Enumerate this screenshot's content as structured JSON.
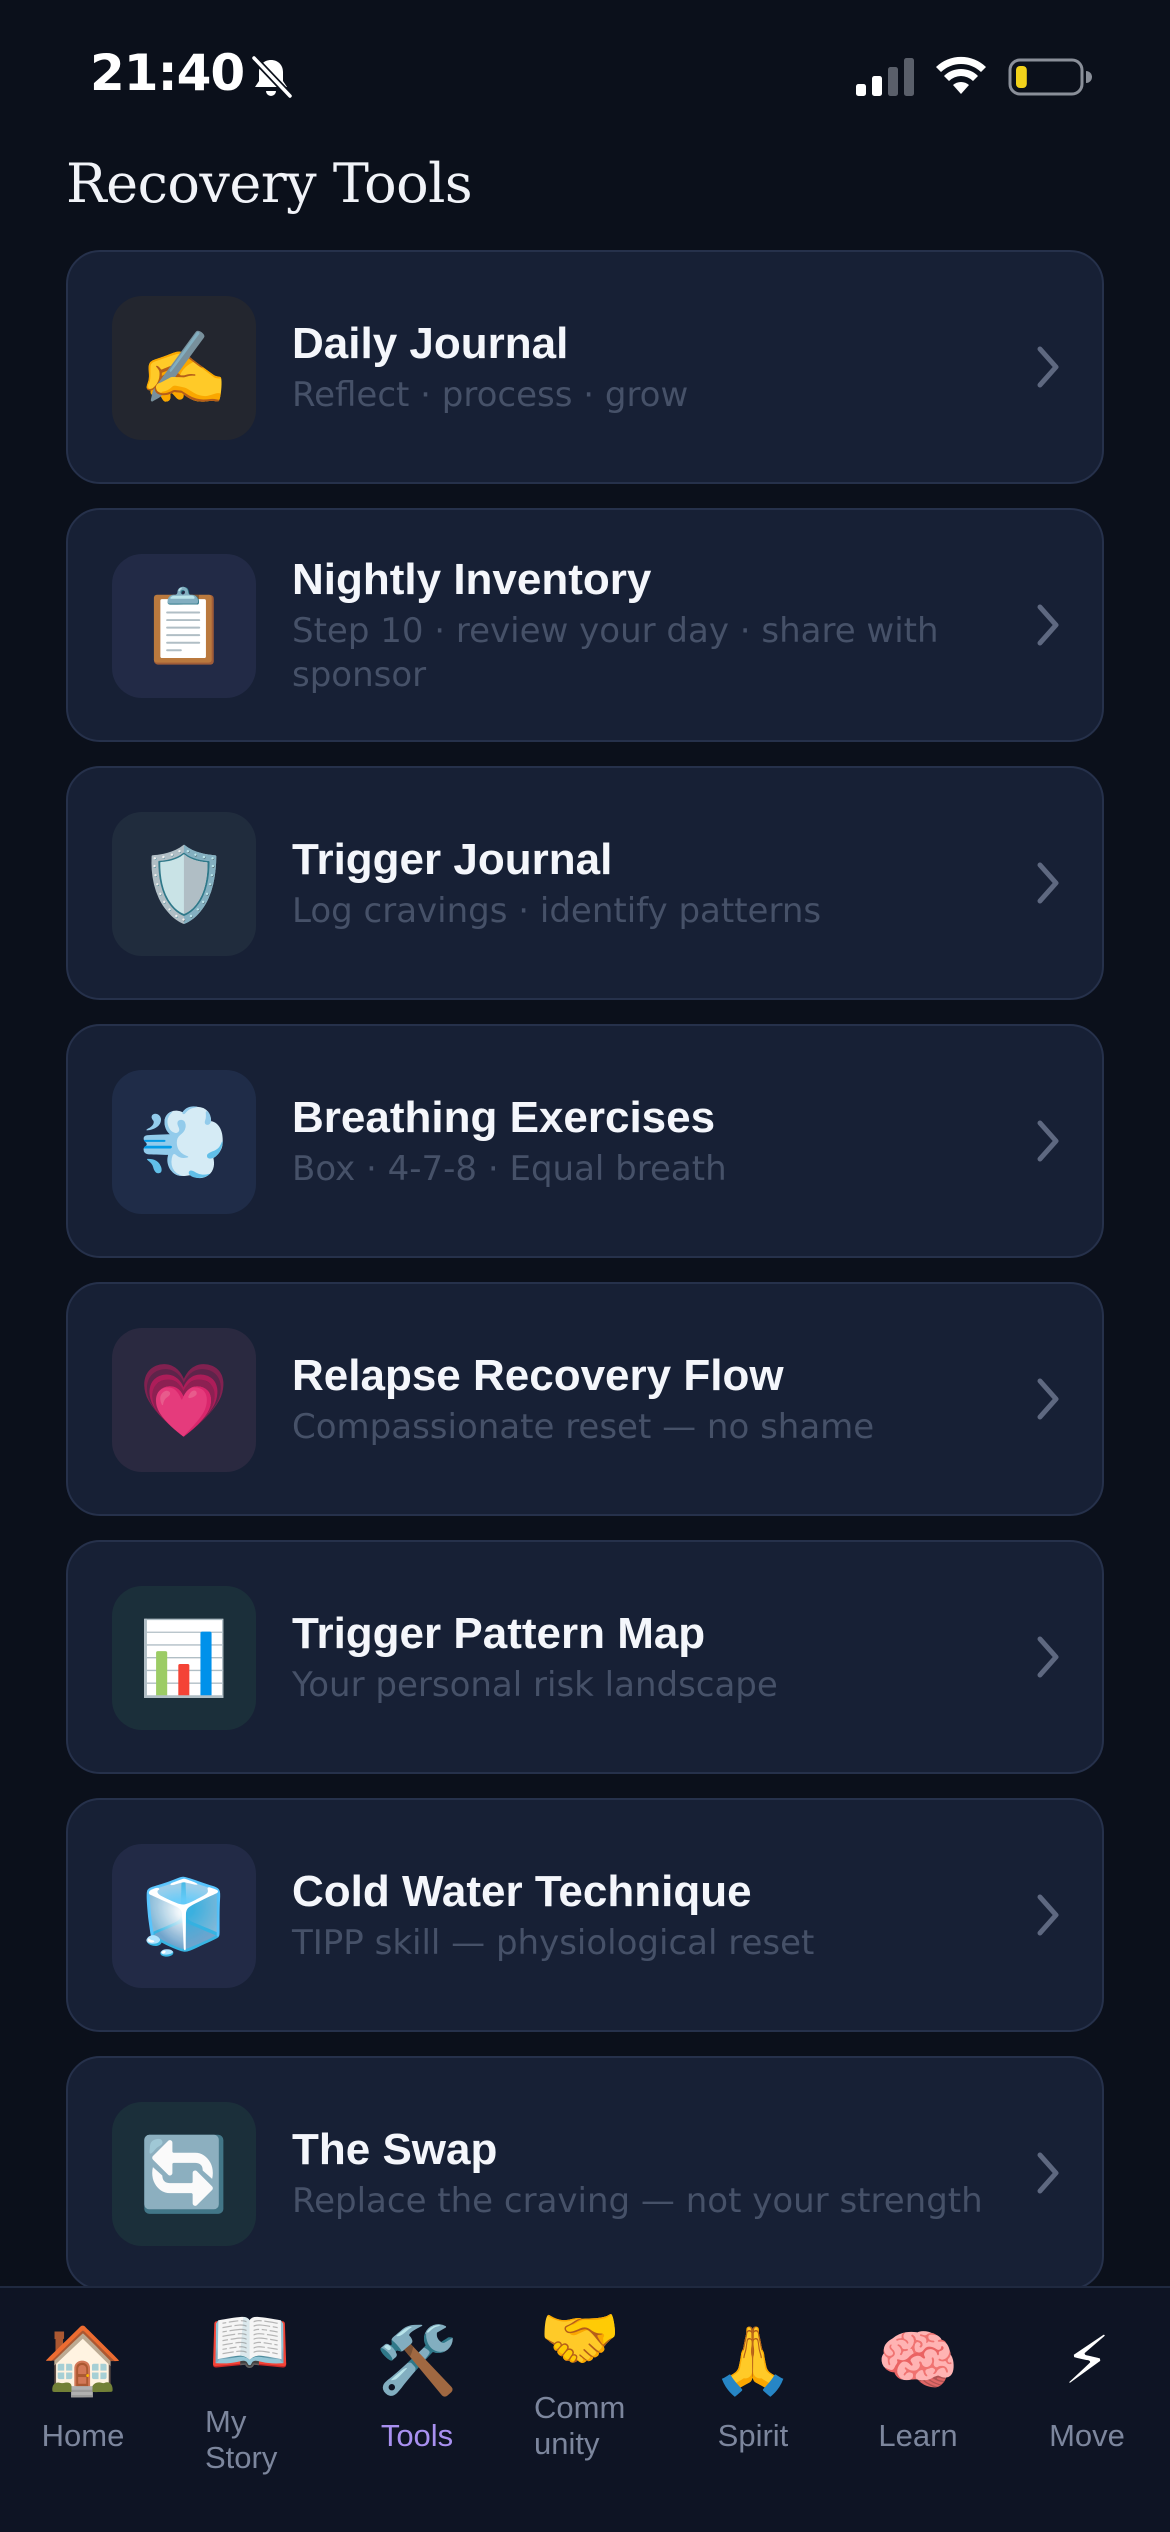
{
  "status_bar": {
    "time": "21:40"
  },
  "page": {
    "title": "Recovery Tools"
  },
  "tools": [
    {
      "title": "Daily Journal",
      "subtitle": "Reflect · process · grow",
      "icon": "✍️",
      "icon_name": "writing-hand-icon",
      "icon_bg": "#23262f"
    },
    {
      "title": "Nightly Inventory",
      "subtitle": "Step 10 · review your day · share with sponsor",
      "icon": "📋",
      "icon_name": "clipboard-icon",
      "icon_bg": "#222a46"
    },
    {
      "title": "Trigger Journal",
      "subtitle": "Log cravings · identify patterns",
      "icon": "🛡️",
      "icon_name": "shield-icon",
      "icon_bg": "#202c3d"
    },
    {
      "title": "Breathing Exercises",
      "subtitle": "Box · 4-7-8 · Equal breath",
      "icon": "💨",
      "icon_name": "wind-icon",
      "icon_bg": "#1f2c48"
    },
    {
      "title": "Relapse Recovery Flow",
      "subtitle": "Compassionate reset — no shame",
      "icon": "💗",
      "icon_name": "heart-icon",
      "icon_bg": "#2a2940"
    },
    {
      "title": "Trigger Pattern Map",
      "subtitle": "Your personal risk landscape",
      "icon": "📊",
      "icon_name": "bar-chart-icon",
      "icon_bg": "#1b2f3a"
    },
    {
      "title": "Cold Water Technique",
      "subtitle": "TIPP skill — physiological reset",
      "icon": "🧊",
      "icon_name": "ice-cube-icon",
      "icon_bg": "#222a46"
    },
    {
      "title": "The Swap",
      "subtitle": "Replace the craving — not your strength",
      "icon": "🔄",
      "icon_name": "swap-arrows-icon",
      "icon_bg": "#1b2f3a"
    }
  ],
  "nav": [
    {
      "label": "Home",
      "icon": "🏠",
      "icon_name": "house-icon"
    },
    {
      "label": "My Story",
      "icon": "📖",
      "icon_name": "open-book-icon"
    },
    {
      "label": "Tools",
      "icon": "🛠️",
      "icon_name": "tools-icon"
    },
    {
      "label": "Community",
      "icon": "🤝",
      "icon_name": "handshake-icon"
    },
    {
      "label": "Spirit",
      "icon": "🙏",
      "icon_name": "praying-hands-icon"
    },
    {
      "label": "Learn",
      "icon": "🧠",
      "icon_name": "brain-icon"
    },
    {
      "label": "Move",
      "icon": "⚡",
      "icon_name": "lightning-icon"
    }
  ],
  "nav_active": "Tools",
  "colors": {
    "background": "#0b101b",
    "card": "#172035",
    "card_border": "#26314b",
    "subtitle": "#465168",
    "nav_active": "#a890f0",
    "battery_level": "#f2d21b"
  },
  "battery_level": 0.18
}
